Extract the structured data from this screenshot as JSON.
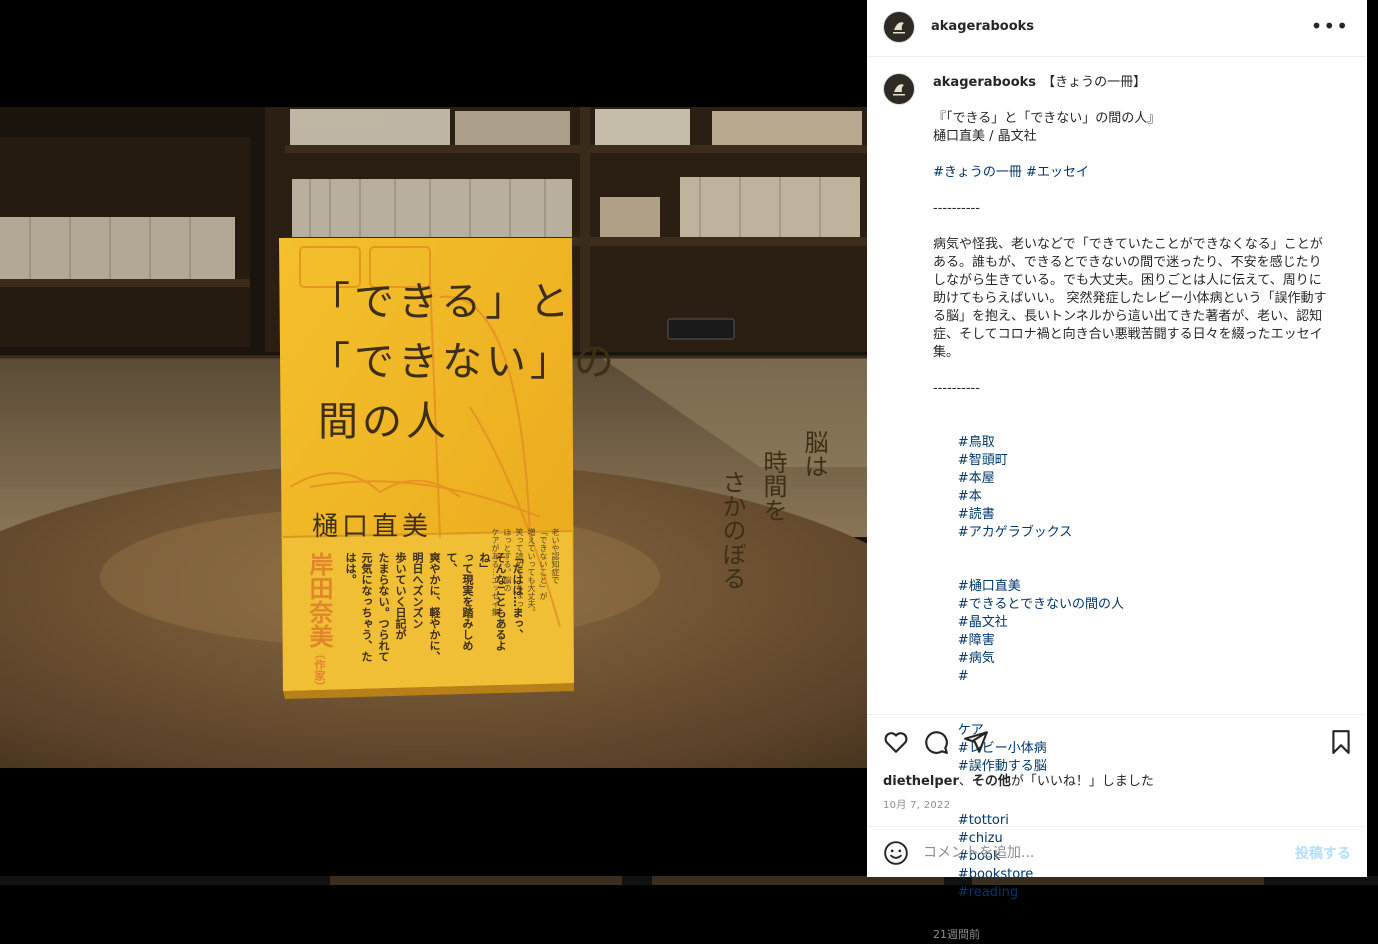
{
  "post": {
    "username": "akagerabooks",
    "more_icon": "more-horizontal-icon"
  },
  "caption": {
    "username": "akagerabooks",
    "title_line": "【きょうの一冊】",
    "book_line": "『「できる」と「できない」の間の人』",
    "author_line": "樋口直美 / 晶文社",
    "genre_tags": [
      "#きょうの一冊",
      "#エッセイ"
    ],
    "divider": "----------",
    "body": "病気や怪我、老いなどで「できていたことができなくなる」ことがある。誰もが、できるとできないの間で迷ったり、不安を感じたりしながら生きている。でも大丈夫。困りごとは人に伝えて、周りに助けてもらえばいい。 突然発症したレビー小体病という「誤作動する脳」を抱え、長いトンネルから這い出てきた著者が、老い、認知症、そしてコロナ禍と向き合い悪戦苦闘する日々を綴ったエッセイ集。",
    "hashtags": [
      [
        "#鳥取",
        "#智頭町",
        "#本屋",
        "#本",
        "#読書",
        "#アカゲラブックス"
      ],
      [
        "#樋口直美",
        "#できるとできないの間の人",
        "#晶文社",
        "#障害",
        "#病気",
        "#"
      ],
      [
        "ケア",
        "#レビー小体病",
        "#誤作動する脳"
      ],
      [
        "#tottori",
        "#chizu",
        "#book",
        "#bookstore",
        "#reading"
      ]
    ],
    "time_ago": "21週間前"
  },
  "likes": {
    "user": "diethelper",
    "separator": "、",
    "others": "その他",
    "suffix": "が「いいね！」しました"
  },
  "post_date": "10月 7, 2022",
  "comment": {
    "placeholder": "コメントを追加...",
    "post_label": "投稿する"
  },
  "book_cover": {
    "title_line1": "「できる」と",
    "title_line2": "「できない」の",
    "title_line3": "間の人",
    "subtitle_col1": "脳は",
    "subtitle_col2": "時間を",
    "subtitle_col3": "さかのぼる",
    "author": "樋口直美",
    "illustrator": "岸田奈美",
    "illustrator_role": "（作家）",
    "obi_text": [
      "「たはは…まっ、",
      "そんなこともあるよね」",
      "って現実を踏みしめて、",
      "爽やかに、軽やかに、",
      "明日へズンズン",
      "歩いていく日記が",
      "たまらない。つられて",
      "元気になっちゃう、たはは。"
    ],
    "blurb": [
      "老いや認知症で",
      "「できないこと」が",
      "増えていっても大丈夫。",
      "笑って読めて、ちょっと",
      "ほっとする。脳の",
      "ケアがある…エッセイ集"
    ]
  },
  "colors": {
    "link": "#00376b",
    "muted": "#8e8e8e",
    "post_button": "#b2dffc",
    "book_yellow": "#f2b623"
  }
}
